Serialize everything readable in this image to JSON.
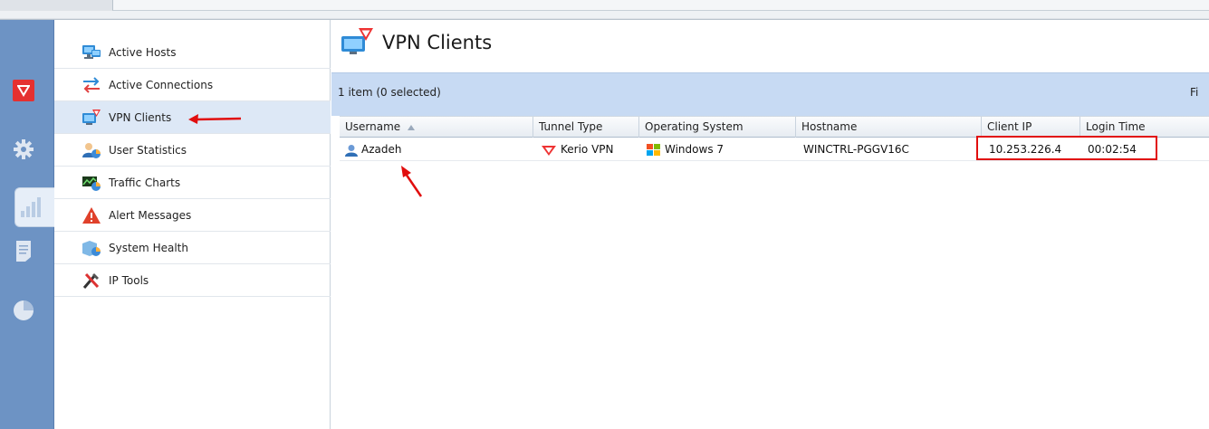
{
  "sidebar": {
    "items": [
      {
        "label": "Active Hosts",
        "icon": "active-hosts-icon",
        "selected": false
      },
      {
        "label": "Active Connections",
        "icon": "active-connections-icon",
        "selected": false
      },
      {
        "label": "VPN Clients",
        "icon": "vpn-clients-icon",
        "selected": true
      },
      {
        "label": "User Statistics",
        "icon": "user-statistics-icon",
        "selected": false
      },
      {
        "label": "Traffic Charts",
        "icon": "traffic-charts-icon",
        "selected": false
      },
      {
        "label": "Alert Messages",
        "icon": "alert-messages-icon",
        "selected": false
      },
      {
        "label": "System Health",
        "icon": "system-health-icon",
        "selected": false
      },
      {
        "label": "IP Tools",
        "icon": "ip-tools-icon",
        "selected": false
      }
    ]
  },
  "main": {
    "title": "VPN Clients",
    "selection_count": "1 item (0 selected)",
    "filter_label": "Fi"
  },
  "grid": {
    "columns": [
      "Username",
      "Tunnel Type",
      "Operating System",
      "Hostname",
      "Client IP",
      "Login Time"
    ],
    "sort_column": "Username",
    "sort_direction": "ascending",
    "rows": [
      {
        "username": "Azadeh",
        "tunnel_type": "Kerio VPN",
        "operating_system": "Windows 7",
        "hostname": "WINCTRL-PGGV16C",
        "client_ip": "10.253.226.4",
        "login_time": "00:02:54"
      }
    ]
  },
  "colors": {
    "accent_blue": "#6d93c4",
    "infobar": "#c7daf3",
    "annotation_red": "#e10e0e",
    "brand_red": "#e53030"
  }
}
